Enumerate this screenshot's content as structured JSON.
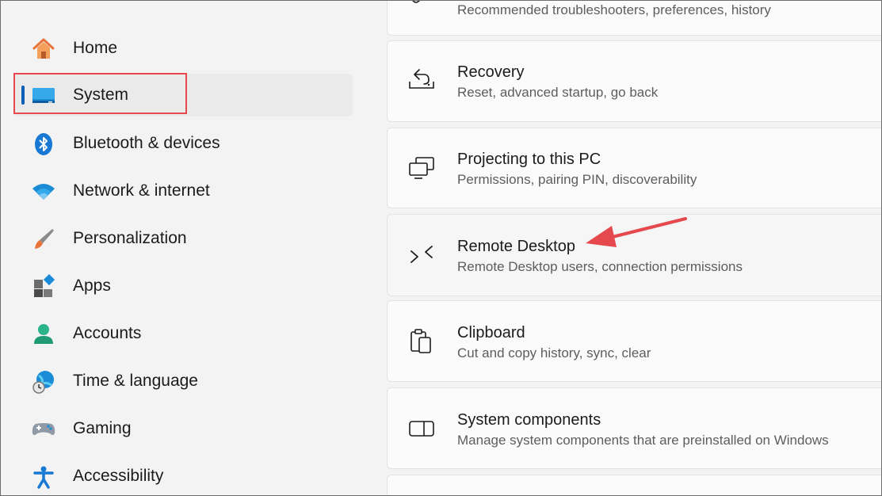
{
  "sidebar": {
    "items": [
      {
        "label": "Home",
        "icon": "home-icon"
      },
      {
        "label": "System",
        "icon": "system-icon",
        "selected": true
      },
      {
        "label": "Bluetooth & devices",
        "icon": "bluetooth-icon"
      },
      {
        "label": "Network & internet",
        "icon": "wifi-icon"
      },
      {
        "label": "Personalization",
        "icon": "brush-icon"
      },
      {
        "label": "Apps",
        "icon": "apps-icon"
      },
      {
        "label": "Accounts",
        "icon": "account-icon"
      },
      {
        "label": "Time & language",
        "icon": "globe-clock-icon"
      },
      {
        "label": "Gaming",
        "icon": "gamepad-icon"
      },
      {
        "label": "Accessibility",
        "icon": "accessibility-icon"
      }
    ]
  },
  "main": {
    "cards": [
      {
        "title": "",
        "subtitle": "Recommended troubleshooters, preferences, history",
        "icon": "wrench-icon"
      },
      {
        "title": "Recovery",
        "subtitle": "Reset, advanced startup, go back",
        "icon": "recovery-icon"
      },
      {
        "title": "Projecting to this PC",
        "subtitle": "Permissions, pairing PIN, discoverability",
        "icon": "projecting-icon"
      },
      {
        "title": "Remote Desktop",
        "subtitle": "Remote Desktop users, connection permissions",
        "icon": "remote-desktop-icon"
      },
      {
        "title": "Clipboard",
        "subtitle": "Cut and copy history, sync, clear",
        "icon": "clipboard-icon"
      },
      {
        "title": "System components",
        "subtitle": "Manage system components that are preinstalled on Windows",
        "icon": "system-components-icon"
      }
    ]
  },
  "colors": {
    "accent": "#0a5fb4",
    "highlight_box": "#e5484d",
    "annotation_arrow": "#e5484d",
    "background": "#f3f3f3",
    "card": "#fbfbfb"
  }
}
